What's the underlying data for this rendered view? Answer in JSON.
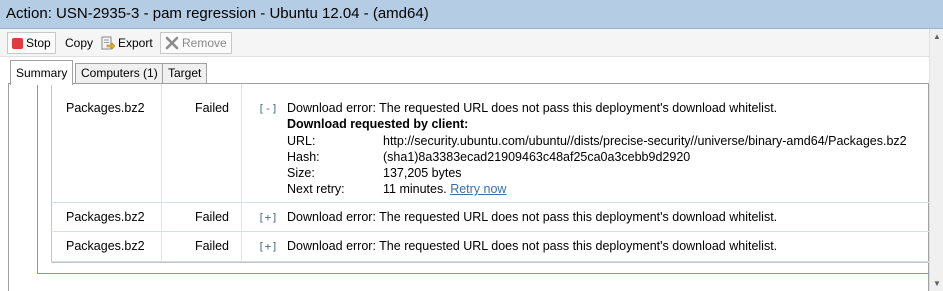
{
  "window": {
    "title": "Action: USN-2935-3 - pam regression - Ubuntu 12.04 - (amd64)"
  },
  "toolbar": {
    "stop_label": "Stop",
    "copy_label": "Copy",
    "export_label": "Export",
    "remove_label": "Remove"
  },
  "tabs": [
    {
      "label": "Summary"
    },
    {
      "label": "Computers (1)"
    },
    {
      "label": "Target"
    }
  ],
  "rows": [
    {
      "file": "Packages.bz2",
      "status": "Failed",
      "toggle": "[-]",
      "message": "Download error:  The requested URL does not pass this deployment's download whitelist.",
      "expanded": true,
      "details": {
        "title": "Download requested by client:",
        "url_label": "URL:",
        "url": "http://security.ubuntu.com/ubuntu//dists/precise-security//universe/binary-amd64/Packages.bz2",
        "hash_label": "Hash:",
        "hash": "(sha1)8a3383ecad21909463c48af25ca0a3cebb9d2920",
        "size_label": "Size:",
        "size": "137,205 bytes",
        "retry_label": "Next retry:",
        "retry": "11 minutes.",
        "retry_link": "Retry now"
      }
    },
    {
      "file": "Packages.bz2",
      "status": "Failed",
      "toggle": "[+]",
      "message": "Download error:  The requested URL does not pass this deployment's download whitelist.",
      "expanded": false
    },
    {
      "file": "Packages.bz2",
      "status": "Failed",
      "toggle": "[+]",
      "message": "Download error:  The requested URL does not pass this deployment's download whitelist.",
      "expanded": false
    }
  ],
  "colors": {
    "titlebar_bg": "#b5cde4",
    "stop_icon": "#e0393e",
    "link": "#3a6fae"
  },
  "icons": {
    "stop": "stop-icon",
    "export": "export-icon",
    "remove": "remove-icon"
  }
}
